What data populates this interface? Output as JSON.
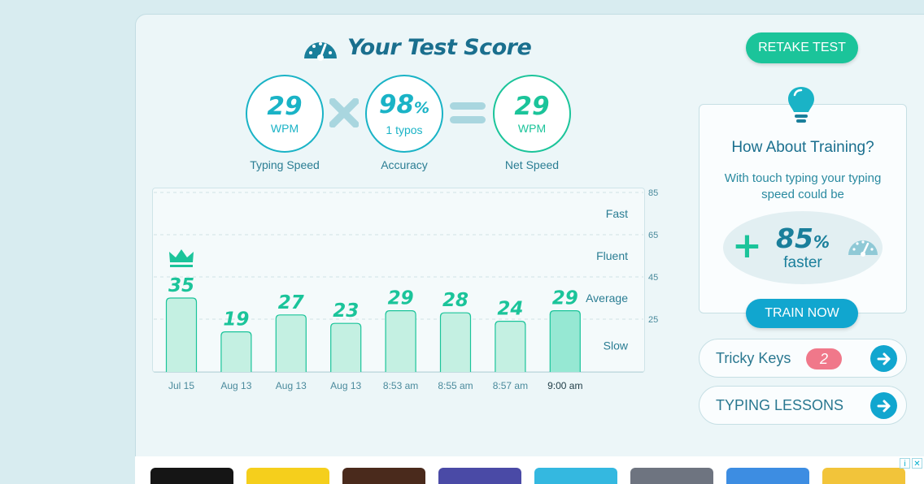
{
  "header": {
    "title": "Your Test Score",
    "retake_label": "RETAKE TEST"
  },
  "metrics": {
    "typing_speed": {
      "value": "29",
      "unit": "WPM",
      "label": "Typing Speed"
    },
    "accuracy": {
      "value": "98",
      "unit_suffix": "%",
      "sub": "1 typos",
      "label": "Accuracy"
    },
    "net_speed": {
      "value": "29",
      "unit": "WPM",
      "label": "Net Speed"
    }
  },
  "chart_data": {
    "type": "bar",
    "categories": [
      "Jul 15",
      "Aug 13",
      "Aug 13",
      "Aug 13",
      "8:53 am",
      "8:55 am",
      "8:57 am",
      "9:00 am"
    ],
    "values": [
      35,
      19,
      27,
      23,
      29,
      28,
      24,
      29
    ],
    "highlight_index": 7,
    "best_index": 0,
    "ylim": [
      0,
      85
    ],
    "y_ticks": [
      25,
      45,
      65,
      85
    ],
    "bands": [
      "Fast",
      "Fluent",
      "Average",
      "Slow"
    ],
    "colors": {
      "bar": "#c4f0e2",
      "bar_highlight": "#96e8d3",
      "bar_stroke": "#1bc49a",
      "value_text": "#1bc49a",
      "grid": "#cfe2e6"
    }
  },
  "training": {
    "title": "How About Training?",
    "text": "With touch typing your typing speed could be",
    "percent": "85",
    "percent_suffix": "%",
    "faster": "faster",
    "button": "TRAIN NOW"
  },
  "tricky_keys": {
    "label": "Tricky Keys",
    "count": "2"
  },
  "typing_lessons": {
    "label": "TYPING LESSONS"
  },
  "ad_icons": [
    "info-icon",
    "close-icon"
  ],
  "colors": {
    "teal": "#1ab3c6",
    "green": "#1bc49a",
    "blue": "#11a6cf",
    "navy": "#1a6f8e",
    "pink": "#f0788a"
  }
}
